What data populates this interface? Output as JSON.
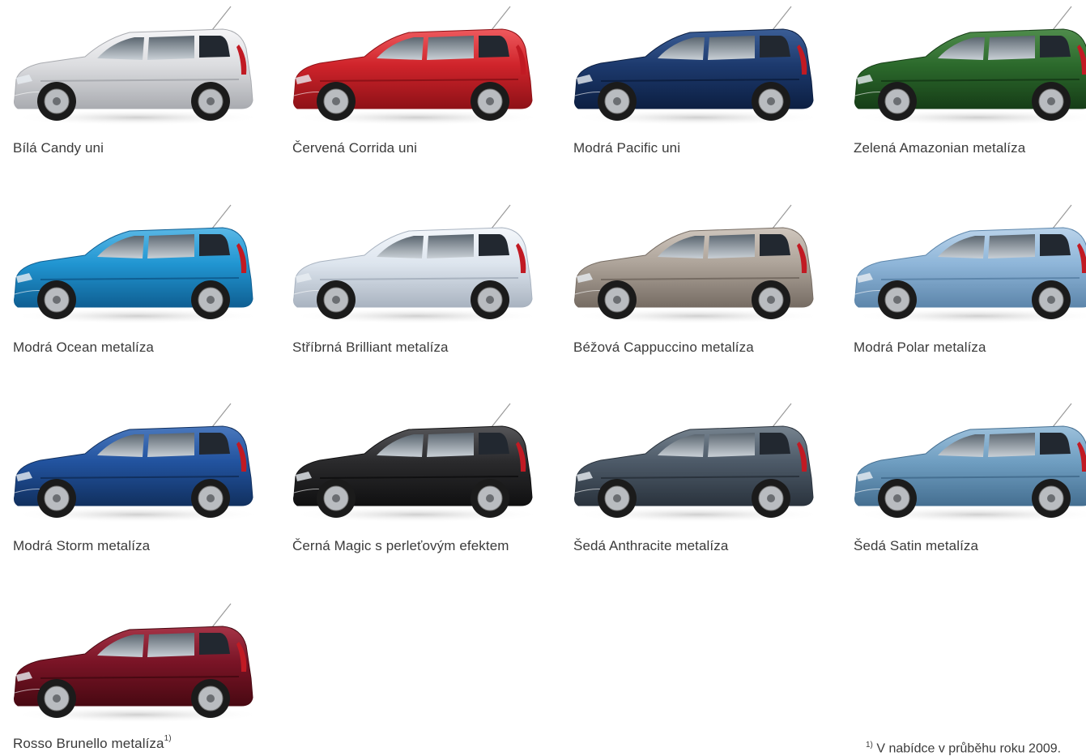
{
  "colors": [
    {
      "label": "Bílá Candy uni",
      "body": "#dcdde0",
      "dark": "#a9abb0",
      "light": "#f5f5f7"
    },
    {
      "label": "Červená Corrida uni",
      "body": "#d0242b",
      "dark": "#8e1117",
      "light": "#ee5a5e"
    },
    {
      "label": "Modrá Pacific uni",
      "body": "#1d3a6e",
      "dark": "#0c1f42",
      "light": "#3b5e96"
    },
    {
      "label": "Zelená Amazonian metalíza",
      "body": "#2c6a2c",
      "dark": "#163d17",
      "light": "#4f8c4c"
    },
    {
      "label": "Modrá Ocean metalíza",
      "body": "#2196d2",
      "dark": "#0f5f93",
      "light": "#5ab8e6"
    },
    {
      "label": "Stříbrná Brilliant metalíza",
      "body": "#dde5ee",
      "dark": "#a9b3c0",
      "light": "#f4f7fb"
    },
    {
      "label": "Béžová Cappuccino metalíza",
      "body": "#aea49a",
      "dark": "#766c63",
      "light": "#cfc6bd"
    },
    {
      "label": "Modrá Polar metalíza",
      "body": "#8fb6d9",
      "dark": "#5d86ab",
      "light": "#bad3ea"
    },
    {
      "label": "Modrá Storm metalíza",
      "body": "#22539f",
      "dark": "#11305f",
      "light": "#4a78bd"
    },
    {
      "label": "Černá Magic s perleťovým efektem",
      "body": "#2a2a2c",
      "dark": "#101011",
      "light": "#565659"
    },
    {
      "label": "Šedá Anthracite metalíza",
      "body": "#4d5a68",
      "dark": "#2a333d",
      "light": "#76838f"
    },
    {
      "label": "Šedá Satin metalíza",
      "body": "#6f9ec1",
      "dark": "#456f91",
      "light": "#9cc0db"
    },
    {
      "label": "Rosso Brunello metalíza",
      "footnote_mark": "1)",
      "body": "#7a1426",
      "dark": "#480912",
      "light": "#a53447"
    }
  ],
  "footnote": {
    "mark": "1)",
    "text": "V nabídce v průběhu roku 2009."
  }
}
